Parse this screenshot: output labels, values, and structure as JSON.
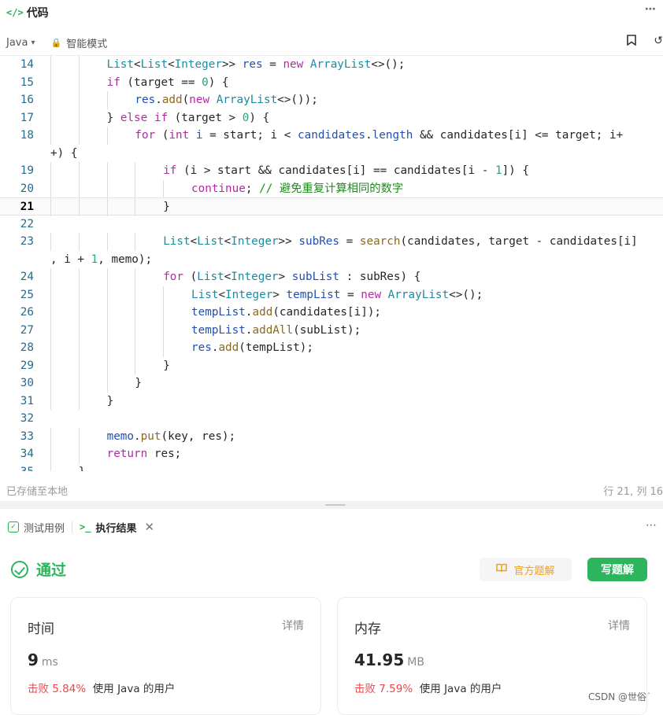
{
  "header": {
    "icon": "code-icon",
    "icon_glyph": "</>",
    "title": "代码",
    "more": "⋯"
  },
  "toolbar": {
    "language": "Java",
    "mode": "智能模式"
  },
  "editor": {
    "lines": [
      {
        "n": "14",
        "indent": 2,
        "tokens": [
          [
            "ty",
            "List"
          ],
          [
            "pl",
            "<"
          ],
          [
            "ty",
            "List"
          ],
          [
            "pl",
            "<"
          ],
          [
            "ty",
            "Integer"
          ],
          [
            "pl",
            ">> "
          ],
          [
            "var",
            "res"
          ],
          [
            "pl",
            " = "
          ],
          [
            "kw",
            "new"
          ],
          [
            "pl",
            " "
          ],
          [
            "ty",
            "ArrayList"
          ],
          [
            "pl",
            "<>();"
          ]
        ]
      },
      {
        "n": "15",
        "indent": 2,
        "tokens": [
          [
            "kw",
            "if"
          ],
          [
            "pl",
            " (target == "
          ],
          [
            "num",
            "0"
          ],
          [
            "pl",
            ") {"
          ]
        ]
      },
      {
        "n": "16",
        "indent": 3,
        "tokens": [
          [
            "var",
            "res"
          ],
          [
            "pl",
            "."
          ],
          [
            "fn",
            "add"
          ],
          [
            "pl",
            "("
          ],
          [
            "kw",
            "new"
          ],
          [
            "pl",
            " "
          ],
          [
            "ty",
            "ArrayList"
          ],
          [
            "pl",
            "<>());"
          ]
        ]
      },
      {
        "n": "17",
        "indent": 2,
        "tokens": [
          [
            "pl",
            "} "
          ],
          [
            "kw",
            "else"
          ],
          [
            "pl",
            " "
          ],
          [
            "kw",
            "if"
          ],
          [
            "pl",
            " (target > "
          ],
          [
            "num",
            "0"
          ],
          [
            "pl",
            ") {"
          ]
        ]
      },
      {
        "n": "18",
        "indent": 3,
        "tokens": [
          [
            "kw",
            "for"
          ],
          [
            "pl",
            " ("
          ],
          [
            "kw",
            "int"
          ],
          [
            "pl",
            " "
          ],
          [
            "var",
            "i"
          ],
          [
            "pl",
            " = start; i < "
          ],
          [
            "var",
            "candidates"
          ],
          [
            "pl",
            "."
          ],
          [
            "var",
            "length"
          ],
          [
            "pl",
            " && candidates[i] <= target; i+"
          ]
        ]
      },
      {
        "n": "",
        "indent": 0,
        "tokens": [
          [
            "pl",
            "+) {"
          ]
        ]
      },
      {
        "n": "19",
        "indent": 4,
        "tokens": [
          [
            "kw",
            "if"
          ],
          [
            "pl",
            " (i > start && candidates[i] == candidates[i - "
          ],
          [
            "num",
            "1"
          ],
          [
            "pl",
            "]) {"
          ]
        ]
      },
      {
        "n": "20",
        "indent": 5,
        "tokens": [
          [
            "kw",
            "continue"
          ],
          [
            "pl",
            "; "
          ],
          [
            "cm",
            "// 避免重复计算相同的数字"
          ]
        ]
      },
      {
        "n": "21",
        "indent": 4,
        "tokens": [
          [
            "pl",
            "}"
          ]
        ],
        "active": true
      },
      {
        "n": "22",
        "indent": 0,
        "tokens": []
      },
      {
        "n": "23",
        "indent": 4,
        "tokens": [
          [
            "ty",
            "List"
          ],
          [
            "pl",
            "<"
          ],
          [
            "ty",
            "List"
          ],
          [
            "pl",
            "<"
          ],
          [
            "ty",
            "Integer"
          ],
          [
            "pl",
            ">> "
          ],
          [
            "var",
            "subRes"
          ],
          [
            "pl",
            " = "
          ],
          [
            "fn",
            "search"
          ],
          [
            "pl",
            "(candidates, target - candidates[i]"
          ]
        ]
      },
      {
        "n": "",
        "indent": 0,
        "tokens": [
          [
            "pl",
            ", i + "
          ],
          [
            "num",
            "1"
          ],
          [
            "pl",
            ", memo);"
          ]
        ]
      },
      {
        "n": "24",
        "indent": 4,
        "tokens": [
          [
            "kw",
            "for"
          ],
          [
            "pl",
            " ("
          ],
          [
            "ty",
            "List"
          ],
          [
            "pl",
            "<"
          ],
          [
            "ty",
            "Integer"
          ],
          [
            "pl",
            "> "
          ],
          [
            "var",
            "subList"
          ],
          [
            "pl",
            " : subRes) {"
          ]
        ]
      },
      {
        "n": "25",
        "indent": 5,
        "tokens": [
          [
            "ty",
            "List"
          ],
          [
            "pl",
            "<"
          ],
          [
            "ty",
            "Integer"
          ],
          [
            "pl",
            "> "
          ],
          [
            "var",
            "tempList"
          ],
          [
            "pl",
            " = "
          ],
          [
            "kw",
            "new"
          ],
          [
            "pl",
            " "
          ],
          [
            "ty",
            "ArrayList"
          ],
          [
            "pl",
            "<>();"
          ]
        ]
      },
      {
        "n": "26",
        "indent": 5,
        "tokens": [
          [
            "var",
            "tempList"
          ],
          [
            "pl",
            "."
          ],
          [
            "fn",
            "add"
          ],
          [
            "pl",
            "(candidates[i]);"
          ]
        ]
      },
      {
        "n": "27",
        "indent": 5,
        "tokens": [
          [
            "var",
            "tempList"
          ],
          [
            "pl",
            "."
          ],
          [
            "fn",
            "addAll"
          ],
          [
            "pl",
            "(subList);"
          ]
        ]
      },
      {
        "n": "28",
        "indent": 5,
        "tokens": [
          [
            "var",
            "res"
          ],
          [
            "pl",
            "."
          ],
          [
            "fn",
            "add"
          ],
          [
            "pl",
            "(tempList);"
          ]
        ]
      },
      {
        "n": "29",
        "indent": 4,
        "tokens": [
          [
            "pl",
            "}"
          ]
        ]
      },
      {
        "n": "30",
        "indent": 3,
        "tokens": [
          [
            "pl",
            "}"
          ]
        ]
      },
      {
        "n": "31",
        "indent": 2,
        "tokens": [
          [
            "pl",
            "}"
          ]
        ]
      },
      {
        "n": "32",
        "indent": 0,
        "tokens": []
      },
      {
        "n": "33",
        "indent": 2,
        "tokens": [
          [
            "var",
            "memo"
          ],
          [
            "pl",
            "."
          ],
          [
            "fn",
            "put"
          ],
          [
            "pl",
            "(key, res);"
          ]
        ]
      },
      {
        "n": "34",
        "indent": 2,
        "tokens": [
          [
            "kw",
            "return"
          ],
          [
            "pl",
            " res;"
          ]
        ]
      },
      {
        "n": "35",
        "indent": 1,
        "tokens": [
          [
            "pl",
            "}"
          ]
        ]
      }
    ]
  },
  "status": {
    "saved": "已存储至本地",
    "position": "行 21, 列 16"
  },
  "tabs": {
    "testcase": "测试用例",
    "result": "执行结果"
  },
  "result": {
    "status": "通过",
    "official_solution": "官方题解",
    "write_solution": "写题解",
    "time": {
      "title": "时间",
      "detail": "详情",
      "value": "9",
      "unit": "ms",
      "beat_label": "击败",
      "beat_pct": "5.84%",
      "suffix": "使用 Java 的用户"
    },
    "memory": {
      "title": "内存",
      "detail": "详情",
      "value": "41.95",
      "unit": "MB",
      "beat_label": "击败",
      "beat_pct": "7.59%",
      "suffix": "使用 Java 的用户"
    }
  },
  "watermark": "CSDN @世俗˙"
}
